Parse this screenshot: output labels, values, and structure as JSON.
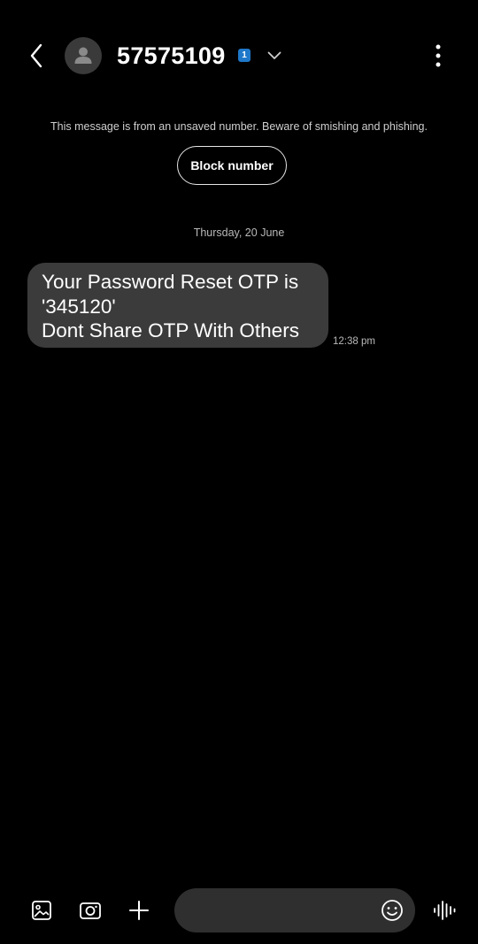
{
  "header": {
    "contact_number": "57575109",
    "sim_badge": "1",
    "icons": {
      "back": "back-arrow-icon",
      "avatar": "person-icon",
      "chevron": "chevron-down-icon",
      "more": "more-vertical-icon"
    }
  },
  "notice": {
    "warning_text": "This message is from an unsaved number. Beware of smishing and phishing.",
    "block_button_label": "Block number"
  },
  "conversation": {
    "date_divider": "Thursday, 20 June",
    "messages": [
      {
        "lines": [
          "Your Password Reset OTP is",
          "'345120'",
          "Dont Share OTP With Others"
        ],
        "time": "12:38 pm"
      }
    ]
  },
  "composer": {
    "input_value": "",
    "icons": [
      "gallery-icon",
      "camera-icon",
      "plus-icon",
      "emoji-icon",
      "voice-icon"
    ]
  },
  "colors": {
    "background": "#000000",
    "bubble": "#3b3b3b",
    "input_background": "#2f2f2f",
    "sim_badge": "#1f78c9",
    "secondary_text": "#b9b9b9"
  }
}
